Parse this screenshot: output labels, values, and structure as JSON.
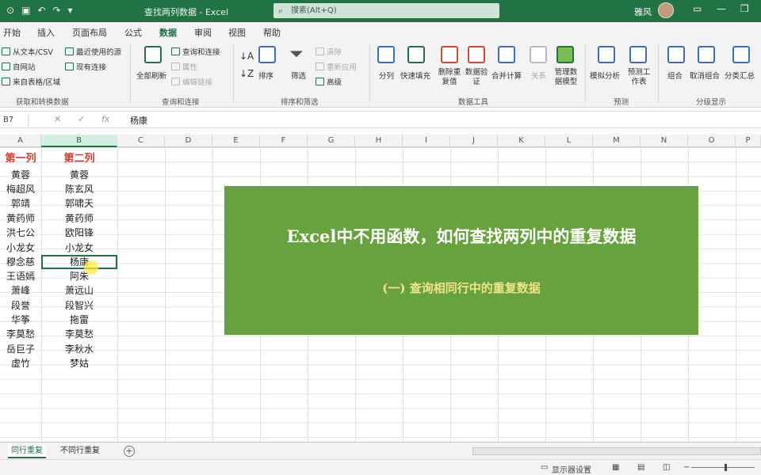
{
  "titlebar": {
    "autosave_icon": "autosave-toggle-icon",
    "document_title": "查找两列数据 - Excel",
    "search_placeholder": "搜索(Alt+Q)",
    "user_name": "雅风",
    "icons": [
      "save-icon",
      "undo-icon",
      "redo-icon",
      "customize-icon"
    ]
  },
  "ribbon_tabs": [
    "开始",
    "插入",
    "页面布局",
    "公式",
    "数据",
    "审阅",
    "视图",
    "帮助"
  ],
  "active_tab": "数据",
  "ribbon": {
    "get_transform": {
      "items": [
        "从文本/CSV",
        "最近使用的源",
        "自网站",
        "现有连接",
        "来自表格/区域"
      ],
      "group_label": "获取和转换数据"
    },
    "queries": {
      "refresh_all": "全部刷新",
      "items": [
        "查询和连接",
        "属性",
        "编辑链接"
      ],
      "group_label": "查询和连接"
    },
    "sort_filter": {
      "sort": "排序",
      "filter": "筛选",
      "items": [
        "清除",
        "重新应用",
        "高级"
      ],
      "group_label": "排序和筛选"
    },
    "data_tools": {
      "items": [
        "分列",
        "快速填充",
        "删除重复值",
        "数据验证",
        "合并计算",
        "关系",
        "管理数据模型"
      ],
      "group_label": "数据工具"
    },
    "forecast": {
      "items": [
        "模拟分析",
        "预测工作表"
      ],
      "group_label": "预测"
    },
    "outline": {
      "items": [
        "组合",
        "取消组合",
        "分类汇总"
      ],
      "group_label": "分级显示"
    }
  },
  "formula_bar": {
    "name_box": "B7",
    "formula": "杨康"
  },
  "columns": [
    "A",
    "B",
    "C",
    "D",
    "E",
    "F",
    "G",
    "H",
    "I",
    "J",
    "K",
    "L",
    "M",
    "N",
    "O",
    "P"
  ],
  "sheet": {
    "header_a": "第一列",
    "header_b": "第二列",
    "col_a": [
      "黄蓉",
      "梅超风",
      "郭靖",
      "黄药师",
      "洪七公",
      "小龙女",
      "穆念慈",
      "王语嫣",
      "萧峰",
      "段誉",
      "华筝",
      "李莫愁",
      "岳巨子",
      "虚竹"
    ],
    "col_b": [
      "黄蓉",
      "陈玄风",
      "郭啸天",
      "黄药师",
      "欧阳锋",
      "小龙女",
      "杨康",
      "阿朱",
      "萧远山",
      "段智兴",
      "拖雷",
      "李莫愁",
      "李秋水",
      "梦姑"
    ]
  },
  "banner": {
    "title": "Excel中不用函数，如何查找两列中的重复数据",
    "subtitle": "(一) 查询相同行中的重复数据",
    "color": "#67a23f"
  },
  "sheet_tabs": [
    "同行重复",
    "不同行重复"
  ],
  "active_sheet": "同行重复",
  "status": {
    "display_settings": "显示器设置"
  },
  "colors": {
    "excel_green": "#217346",
    "header_red": "#d23a2a"
  }
}
